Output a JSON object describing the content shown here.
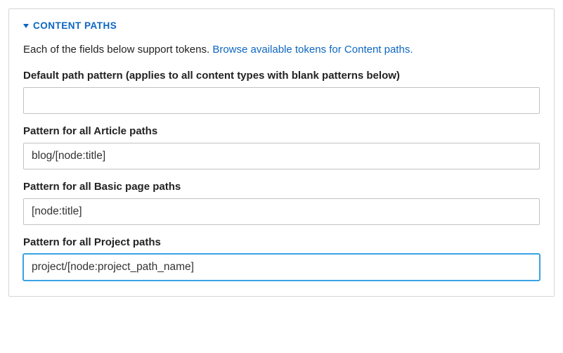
{
  "legend": "CONTENT PATHS",
  "intro_text": "Each of the fields below support tokens. ",
  "intro_link": "Browse available tokens for Content paths.",
  "fields": {
    "default": {
      "label": "Default path pattern (applies to all content types with blank patterns below)",
      "value": ""
    },
    "article": {
      "label": "Pattern for all Article paths",
      "value": "blog/[node:title]"
    },
    "basic_page": {
      "label": "Pattern for all Basic page paths",
      "value": "[node:title]"
    },
    "project": {
      "label": "Pattern for all Project paths",
      "value": "project/[node:project_path_name]"
    }
  }
}
